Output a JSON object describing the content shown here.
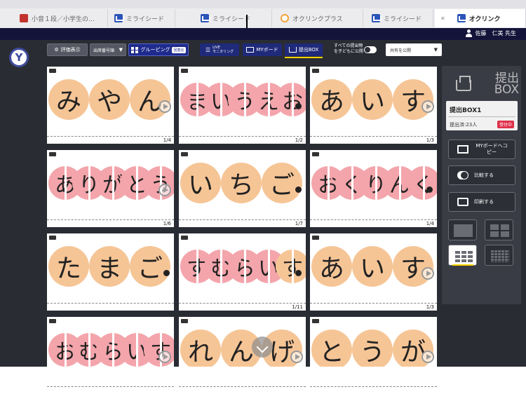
{
  "browser": {
    "tabs": [
      {
        "label": "小音１段／小学生の…",
        "icon": "book-icon",
        "active": false
      },
      {
        "label": "ミライシード",
        "icon": "mirai-icon",
        "active": false
      },
      {
        "label": "ミライシード",
        "icon": "mirai-icon",
        "active": false
      },
      {
        "label": "オクリンクプラス",
        "icon": "oclink-icon",
        "active": false
      },
      {
        "label": "ミライシード",
        "icon": "mirai-icon",
        "active": false
      },
      {
        "label": "オクリンク",
        "icon": "mirai-icon",
        "active": true
      }
    ]
  },
  "user": {
    "name": "佐藤　仁美 先生"
  },
  "toolbar": {
    "eval_label": "評価表示",
    "sort_value": "出席番号順",
    "grouping_label": "グルーピング",
    "grouping_tag": "回答比",
    "live_label": "LIVE",
    "live_sub": "モニタリング",
    "myboard_label": "MYボード",
    "submit_box_label": "提出BOX",
    "publish_label": "すべての提出物を子どもに公開",
    "share_value": "共有を公開"
  },
  "cards": [
    {
      "chars": [
        "み",
        "や",
        "ん"
      ],
      "colors": [
        "o",
        "o",
        "o"
      ],
      "count": "1/4",
      "end": "play"
    },
    {
      "chars": [
        "ま",
        "い",
        "う",
        "え",
        "お"
      ],
      "colors": [
        "p",
        "p",
        "p",
        "p",
        "p"
      ],
      "count": "1/2",
      "end": "dot"
    },
    {
      "chars": [
        "あ",
        "い",
        "す"
      ],
      "colors": [
        "o",
        "o",
        "o"
      ],
      "count": "1/3",
      "end": "play"
    },
    {
      "chars": [
        "あ",
        "り",
        "が",
        "と",
        "う"
      ],
      "colors": [
        "p",
        "p",
        "p",
        "p",
        "p"
      ],
      "count": "1/6",
      "end": "play"
    },
    {
      "chars": [
        "い",
        "ち",
        "ご"
      ],
      "colors": [
        "o",
        "o",
        "o"
      ],
      "count": "1/7",
      "end": "dot"
    },
    {
      "chars": [
        "お",
        "く",
        "り",
        "ん",
        "く"
      ],
      "colors": [
        "p",
        "p",
        "p",
        "p",
        "p"
      ],
      "count": "1/4",
      "end": "dot"
    },
    {
      "chars": [
        "た",
        "ま",
        "ご"
      ],
      "colors": [
        "o",
        "o",
        "o"
      ],
      "count": "",
      "end": "dot"
    },
    {
      "chars": [
        "す",
        "む",
        "ら",
        "い",
        "す"
      ],
      "colors": [
        "p",
        "p",
        "p",
        "p",
        "o"
      ],
      "count": "1/11",
      "end": "dot"
    },
    {
      "chars": [
        "あ",
        "い",
        "す"
      ],
      "colors": [
        "o",
        "o",
        "o"
      ],
      "count": "1/3",
      "end": "play"
    },
    {
      "chars": [
        "お",
        "む",
        "ら",
        "い",
        "す"
      ],
      "colors": [
        "p",
        "p",
        "p",
        "p",
        "p"
      ],
      "count": "",
      "end": "play"
    },
    {
      "chars": [
        "れ",
        "ん",
        "げ"
      ],
      "colors": [
        "o",
        "o",
        "o"
      ],
      "count": "",
      "end": "play"
    },
    {
      "chars": [
        "と",
        "う",
        "が"
      ],
      "colors": [
        "o",
        "o",
        "o"
      ],
      "count": "",
      "end": "play"
    }
  ],
  "panel": {
    "title_line1": "提出",
    "title_line2": "BOX",
    "box_name": "提出BOX1",
    "submitted": "提出済:23人",
    "status": "受付中",
    "copy_label": "MYボードへコピー",
    "compare_label": "比較する",
    "print_label": "印刷する"
  },
  "colors": {
    "accent": "#ffd400",
    "header": "#14143a",
    "orange": "#f6c596",
    "pink": "#f3a5ab"
  }
}
